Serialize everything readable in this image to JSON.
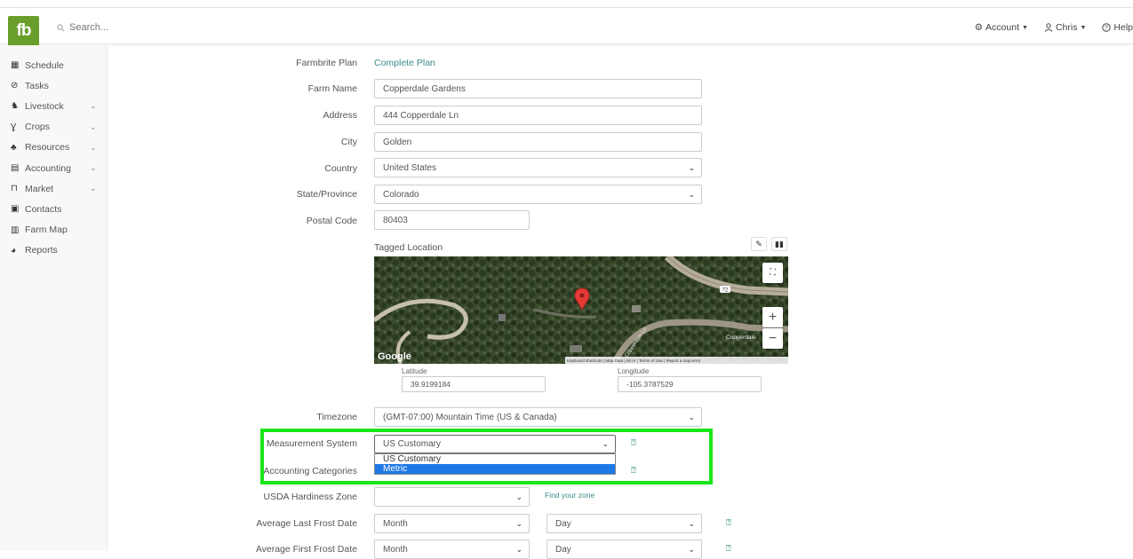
{
  "topbar": {
    "logo_text": "fb",
    "search_placeholder": "Search...",
    "account_label": "Account",
    "user_label": "Chris",
    "help_label": "Help"
  },
  "sidebar": {
    "items": [
      {
        "label": "Schedule",
        "icon": "calendar-icon",
        "chevron": false
      },
      {
        "label": "Tasks",
        "icon": "check-circle-icon",
        "chevron": false
      },
      {
        "label": "Livestock",
        "icon": "horse-icon",
        "chevron": true
      },
      {
        "label": "Crops",
        "icon": "seedling-icon",
        "chevron": true
      },
      {
        "label": "Resources",
        "icon": "people-icon",
        "chevron": true
      },
      {
        "label": "Accounting",
        "icon": "calculator-icon",
        "chevron": true
      },
      {
        "label": "Market",
        "icon": "store-icon",
        "chevron": true
      },
      {
        "label": "Contacts",
        "icon": "address-book-icon",
        "chevron": false
      },
      {
        "label": "Farm Map",
        "icon": "map-icon",
        "chevron": false
      },
      {
        "label": "Reports",
        "icon": "chart-pie-icon",
        "chevron": false
      }
    ]
  },
  "form": {
    "plan_label": "Farmbrite Plan",
    "plan_value": "Complete Plan",
    "farm_name_label": "Farm Name",
    "farm_name_value": "Copperdale Gardens",
    "address_label": "Address",
    "address_value": "444 Copperdale Ln",
    "city_label": "City",
    "city_value": "Golden",
    "country_label": "Country",
    "country_value": "United States",
    "state_label": "State/Province",
    "state_value": "Colorado",
    "postal_label": "Postal Code",
    "postal_value": "80403",
    "tagged_location_label": "Tagged Location",
    "latitude_label": "Latitude",
    "latitude_value": "39.9199184",
    "longitude_label": "Longitude",
    "longitude_value": "-105.3787529",
    "timezone_label": "Timezone",
    "timezone_value": "(GMT-07:00) Mountain Time (US & Canada)",
    "measurement_label": "Measurement System",
    "measurement_value": "US Customary",
    "measurement_options": [
      "US Customary",
      "Metric"
    ],
    "accounting_categories_label": "Accounting Categories",
    "usda_label": "USDA Hardiness Zone",
    "usda_value": "",
    "find_zone_link": "Find your zone",
    "last_frost_label": "Average Last Frost Date",
    "first_frost_label": "Average First Frost Date",
    "month_placeholder": "Month",
    "day_placeholder": "Day"
  },
  "map": {
    "google_label": "Google",
    "route_badge": "72",
    "road_label": "Copperdale",
    "road_label_2": "Copperdale Ln",
    "footer": "Keyboard shortcuts | Map Data | 50 m | Terms of Use | Report a map error"
  }
}
